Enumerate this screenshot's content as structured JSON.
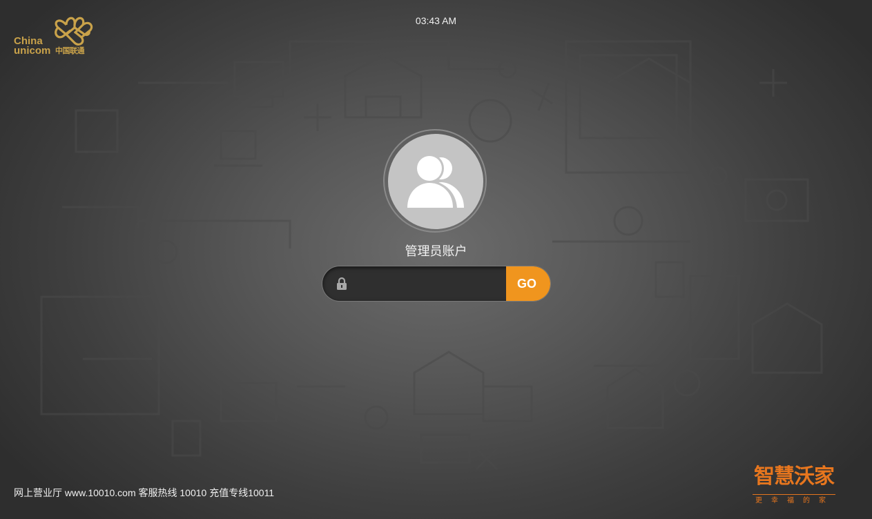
{
  "header": {
    "clock": "03:43 AM",
    "logo": {
      "line1": "China",
      "line2": "unicom",
      "cn": "中国联通"
    }
  },
  "login": {
    "account_label": "管理员账户",
    "password_placeholder": "",
    "go_label": "GO"
  },
  "footer": {
    "text": "网上营业厅 www.10010.com 客服热线 10010 充值专线10011"
  },
  "brand": {
    "title": "智慧沃家",
    "subtitle": "更幸福的家"
  },
  "colors": {
    "accent": "#f0951e",
    "logo_gold": "#c9a24a",
    "brand_orange": "#e7761e"
  },
  "icons": [
    "unicom-knot-icon",
    "users-icon",
    "lock-icon"
  ]
}
